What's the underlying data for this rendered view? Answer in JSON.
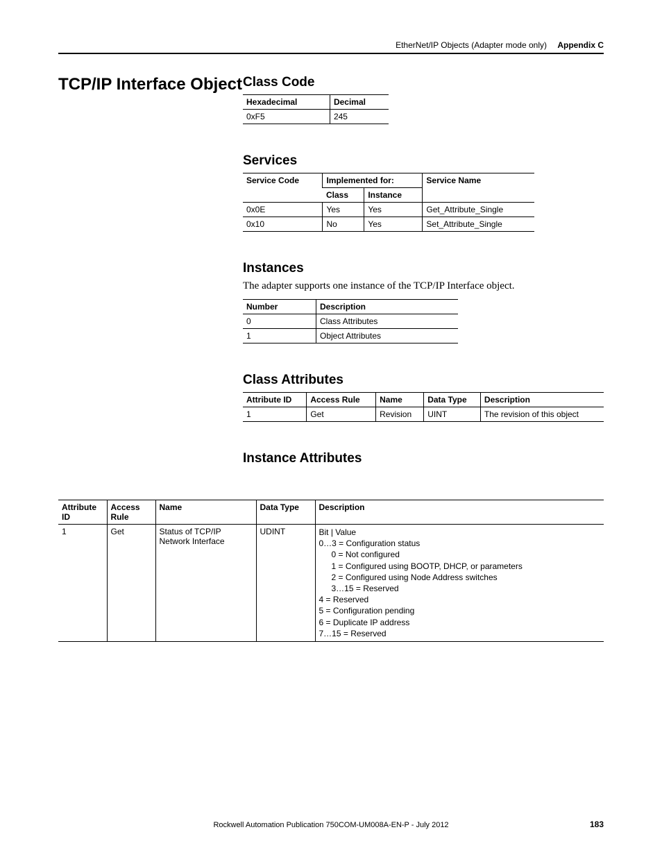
{
  "header": {
    "left_text": "EtherNet/IP Objects (Adapter mode only)",
    "right_text": "Appendix C"
  },
  "page_title": "TCP/IP Interface Object",
  "class_code": {
    "heading": "Class Code",
    "headers": [
      "Hexadecimal",
      "Decimal"
    ],
    "row": [
      "0xF5",
      "245"
    ]
  },
  "services": {
    "heading": "Services",
    "headers_top": [
      "Service Code",
      "Implemented for:",
      "Service Name"
    ],
    "headers_sub": [
      "Class",
      "Instance"
    ],
    "rows": [
      [
        "0x0E",
        "Yes",
        "Yes",
        "Get_Attribute_Single"
      ],
      [
        "0x10",
        "No",
        "Yes",
        "Set_Attribute_Single"
      ]
    ]
  },
  "instances": {
    "heading": "Instances",
    "intro": "The adapter supports one instance of the TCP/IP Interface object.",
    "headers": [
      "Number",
      "Description"
    ],
    "rows": [
      [
        "0",
        "Class Attributes"
      ],
      [
        "1",
        "Object Attributes"
      ]
    ]
  },
  "class_attributes": {
    "heading": "Class Attributes",
    "headers": [
      "Attribute ID",
      "Access Rule",
      "Name",
      "Data Type",
      "Description"
    ],
    "rows": [
      [
        "1",
        "Get",
        "Revision",
        "UINT",
        "The revision of this object"
      ]
    ]
  },
  "instance_attributes": {
    "heading": "Instance Attributes",
    "headers": [
      "Attribute ID",
      "Access Rule",
      "Name",
      "Data Type",
      "Description"
    ],
    "row1": {
      "id": "1",
      "access": "Get",
      "name": "Status of TCP/IP Network Interface",
      "dtype": "UDINT",
      "desc_lines": [
        "Bit | Value",
        "0…3 = Configuration status",
        "0 = Not configured",
        "1 = Configured using BOOTP, DHCP, or parameters",
        "2 = Configured using Node Address switches",
        "3…15 = Reserved",
        "4 = Reserved",
        "5 = Configuration pending",
        "6 = Duplicate IP address",
        "7…15 = Reserved"
      ]
    }
  },
  "footer": {
    "pub": "Rockwell Automation Publication 750COM-UM008A-EN-P - July 2012",
    "page": "183"
  }
}
